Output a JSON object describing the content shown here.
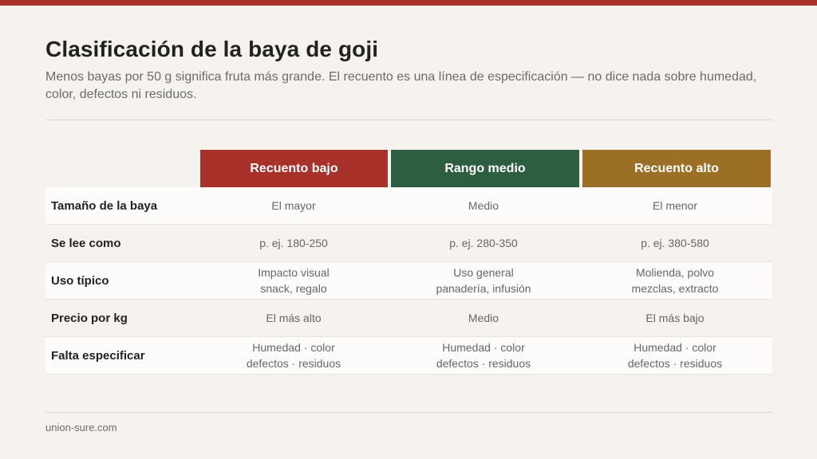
{
  "title": "Clasificación de la baya de goji",
  "subtitle": "Menos bayas por 50 g significa fruta más grande. El recuento es una línea de especificación — no dice nada sobre humedad, color, defectos ni residuos.",
  "footer": "union-sure.com",
  "colors": {
    "accent": "#a8312a",
    "col1": "#a8312a",
    "col2": "#2e5e41",
    "col3": "#9b6f26"
  },
  "table": {
    "columns": [
      "Recuento bajo",
      "Rango medio",
      "Recuento alto"
    ],
    "rows": [
      {
        "label": "Tamaño de la baya",
        "cells": [
          [
            "El mayor"
          ],
          [
            "Medio"
          ],
          [
            "El menor"
          ]
        ]
      },
      {
        "label": "Se lee como",
        "cells": [
          [
            "p. ej. 180-250"
          ],
          [
            "p. ej. 280-350"
          ],
          [
            "p. ej. 380-580"
          ]
        ]
      },
      {
        "label": "Uso típico",
        "cells": [
          [
            "Impacto visual",
            "snack, regalo"
          ],
          [
            "Uso general",
            "panadería, infusión"
          ],
          [
            "Molienda, polvo",
            "mezclas, extracto"
          ]
        ]
      },
      {
        "label": "Precio por kg",
        "cells": [
          [
            "El más alto"
          ],
          [
            "Medio"
          ],
          [
            "El más bajo"
          ]
        ]
      },
      {
        "label": "Falta especificar",
        "cells": [
          [
            "Humedad · color",
            "defectos · residuos"
          ],
          [
            "Humedad · color",
            "defectos · residuos"
          ],
          [
            "Humedad · color",
            "defectos · residuos"
          ]
        ]
      }
    ]
  }
}
